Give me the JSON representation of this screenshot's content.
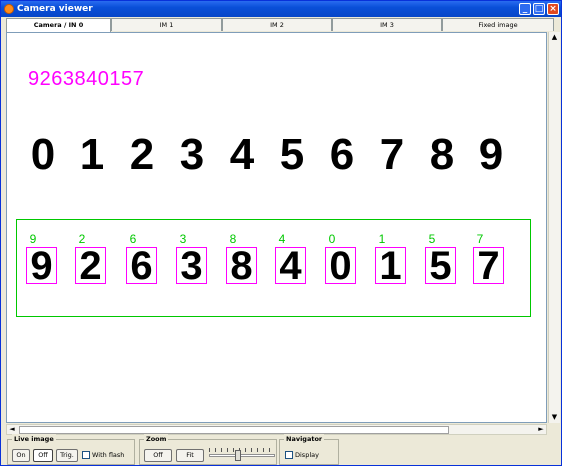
{
  "window": {
    "title": "Camera viewer",
    "accent": "#0a4fd8",
    "controls": [
      "minimize-icon",
      "maximize-icon",
      "close-icon"
    ]
  },
  "tabs": [
    {
      "label": "Camera / IN 0",
      "active": true
    },
    {
      "label": "IM 1",
      "active": false
    },
    {
      "label": "IM 2",
      "active": false
    },
    {
      "label": "IM 3",
      "active": false
    },
    {
      "label": "Fixed image",
      "active": false
    }
  ],
  "image": {
    "ocr_result": "9263840157",
    "ocr_color": "#ff00ff",
    "printed_digits": [
      "0",
      "1",
      "2",
      "3",
      "4",
      "5",
      "6",
      "7",
      "8",
      "9"
    ],
    "detections": [
      {
        "label": "9",
        "digit": "9"
      },
      {
        "label": "2",
        "digit": "2"
      },
      {
        "label": "6",
        "digit": "6"
      },
      {
        "label": "3",
        "digit": "3"
      },
      {
        "label": "8",
        "digit": "8"
      },
      {
        "label": "4",
        "digit": "4"
      },
      {
        "label": "0",
        "digit": "0"
      },
      {
        "label": "1",
        "digit": "1"
      },
      {
        "label": "5",
        "digit": "5"
      },
      {
        "label": "7",
        "digit": "7"
      }
    ],
    "roi_color": "#00c800",
    "box_color": "#ff00ff"
  },
  "controls": {
    "live_image": {
      "title": "Live image",
      "on_label": "On",
      "off_label": "Off",
      "trig_label": "Trig.",
      "flash_label": "With flash",
      "flash_checked": false
    },
    "zoom": {
      "title": "Zoom",
      "off_label": "Off",
      "fit_label": "Fit"
    },
    "navigator": {
      "title": "Navigator",
      "display_label": "Display",
      "display_checked": false
    }
  }
}
